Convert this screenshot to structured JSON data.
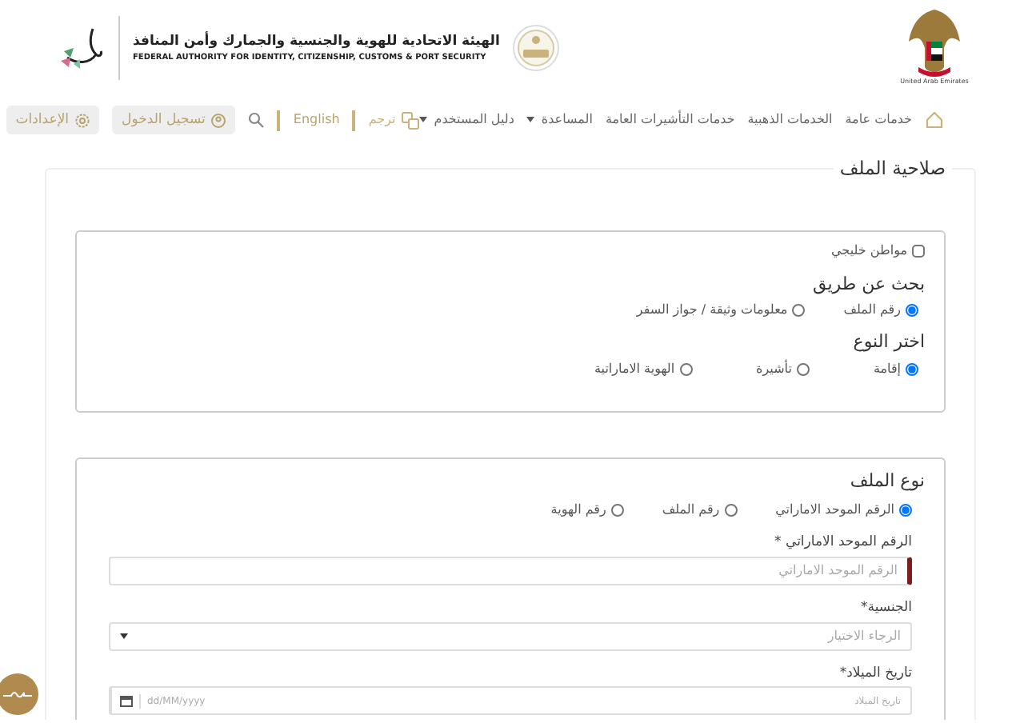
{
  "header": {
    "emblem_caption": "United Arab Emirates",
    "authority_name_ar": "الهيئة الاتحادية للهوية والجنسية والجمارك وأمن المنافذ",
    "authority_name_en": "FEDERAL AUTHORITY FOR IDENTITY, CITIZENSHIP, CUSTOMS & PORT SECURITY"
  },
  "nav": {
    "items": [
      {
        "label": "خدمات عامة",
        "dropdown": false
      },
      {
        "label": "الخدمات الذهبية",
        "dropdown": false
      },
      {
        "label": "خدمات التأشيرات العامة",
        "dropdown": false
      },
      {
        "label": "المساعدة",
        "dropdown": true
      },
      {
        "label": "دليل المستخدم",
        "dropdown": true
      }
    ],
    "translate": "ترجم",
    "language": "English",
    "login": "تسجيل الدخول",
    "settings": "الإعدادات"
  },
  "section_title": "صلاحية الملف",
  "search_panel": {
    "gcc_citizen": {
      "label": "مواطن خليجي",
      "checked": false
    },
    "search_by": {
      "title": "بحث عن طريق",
      "options": [
        {
          "label": "رقم الملف",
          "selected": true
        },
        {
          "label": "معلومات وثيقة / جواز السفر",
          "selected": false
        }
      ]
    },
    "type": {
      "title": "اختر النوع",
      "options": [
        {
          "label": "إقامة",
          "selected": true
        },
        {
          "label": "تأشيرة",
          "selected": false
        },
        {
          "label": "الهوية الاماراتية",
          "selected": false
        }
      ]
    }
  },
  "file_panel": {
    "title": "نوع الملف",
    "options": [
      {
        "label": "الرقم الموحد الاماراتي",
        "selected": true
      },
      {
        "label": "رقم الملف",
        "selected": false
      },
      {
        "label": "رقم الهوية",
        "selected": false
      }
    ],
    "fields": [
      {
        "kind": "text",
        "label": "الرقم الموحد الاماراتي *",
        "placeholder": "الرقم الموحد الاماراتي"
      },
      {
        "kind": "select",
        "label": "الجنسية*",
        "placeholder": "الرجاء الاختيار"
      },
      {
        "kind": "date",
        "label": "تاريخ الميلاد*",
        "placeholder": "dd/MM/yyyy",
        "hint": "تاريخ الميلاد"
      }
    ]
  }
}
